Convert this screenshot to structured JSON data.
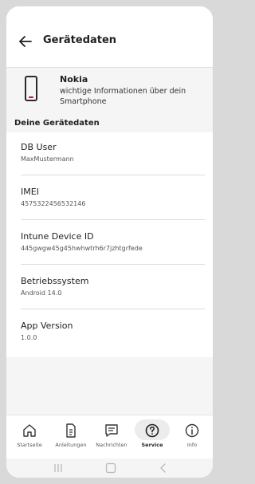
{
  "header": {
    "title": "Gerätedaten",
    "back_icon": "arrow-left-icon"
  },
  "device": {
    "name": "Nokia",
    "description": "wichtige Informationen über dein Smartphone",
    "icon": "smartphone-icon"
  },
  "section_title": "Deine Gerätedaten",
  "items": [
    {
      "label": "DB User",
      "value": "MaxMustermann"
    },
    {
      "label": "IMEI",
      "value": "4575322456532146"
    },
    {
      "label": "Intune Device ID",
      "value": "445gwgw45g45hwhwtrh6r7jzhtgrfede"
    },
    {
      "label": "Betriebssystem",
      "value": "Android 14.0"
    },
    {
      "label": "App Version",
      "value": "1.0.0"
    }
  ],
  "nav": [
    {
      "label": "Startseite",
      "icon": "home-icon"
    },
    {
      "label": "Anleitungen",
      "icon": "document-icon"
    },
    {
      "label": "Nachrichten",
      "icon": "message-icon"
    },
    {
      "label": "Service",
      "icon": "help-circle-icon",
      "active": true
    },
    {
      "label": "Info",
      "icon": "info-icon"
    }
  ],
  "colors": {
    "accent": "#e3000f",
    "background": "#f5f5f5",
    "surface": "#ffffff"
  }
}
